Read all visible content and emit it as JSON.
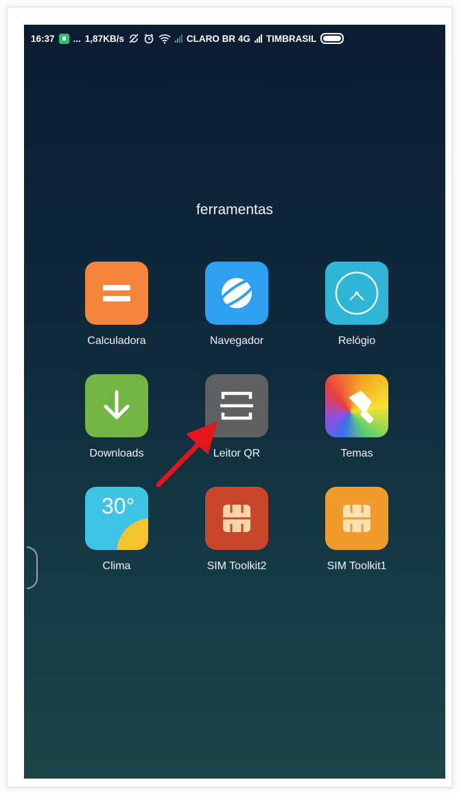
{
  "status_bar": {
    "time": "16:37",
    "dots": "...",
    "net_speed": "1,87KB/s",
    "carrier1": "CLARO BR 4G",
    "carrier2": "TIMBRASIL",
    "icons": [
      "notification-icon",
      "sync-off-icon",
      "alarm-icon",
      "wifi-icon",
      "signal-icon",
      "battery-icon"
    ]
  },
  "folder": {
    "title": "ferramentas",
    "apps": [
      {
        "label": "Calculadora",
        "icon": "calculator-icon",
        "color": "#f5843c"
      },
      {
        "label": "Navegador",
        "icon": "browser-icon",
        "color": "#2f9ff0"
      },
      {
        "label": "Relógio",
        "icon": "clock-icon",
        "color": "#2fb5d6"
      },
      {
        "label": "Downloads",
        "icon": "download-icon",
        "color": "#72b545"
      },
      {
        "label": "Leitor QR",
        "icon": "qr-scanner-icon",
        "color": "#5f6062"
      },
      {
        "label": "Temas",
        "icon": "themes-brush-icon",
        "color": "#e5573f"
      },
      {
        "label": "Clima",
        "icon": "weather-icon",
        "color": "#3ec3e5",
        "temperature": "30°"
      },
      {
        "label": "SIM Toolkit2",
        "icon": "sim-card-icon",
        "color": "#c9462d"
      },
      {
        "label": "SIM Toolkit1",
        "icon": "sim-card-icon",
        "color": "#f19b2c"
      }
    ]
  },
  "annotation": {
    "color": "#e3161b",
    "points_to": "Leitor QR"
  }
}
